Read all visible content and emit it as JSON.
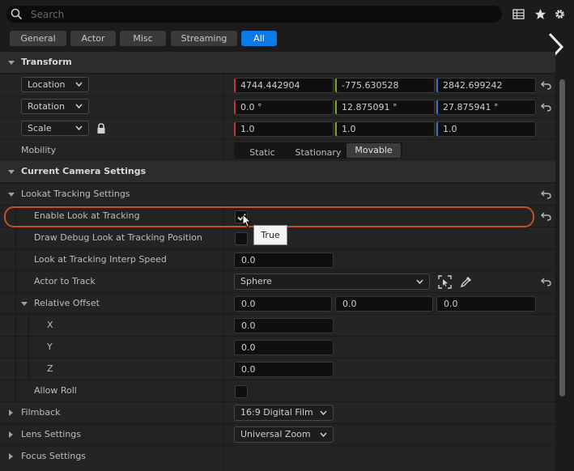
{
  "search": {
    "placeholder": "Search"
  },
  "toolbar_icons": [
    "grid-view-icon",
    "star-icon",
    "gear-icon"
  ],
  "filters": [
    {
      "label": "General",
      "active": false
    },
    {
      "label": "Actor",
      "active": false
    },
    {
      "label": "Misc",
      "active": false
    },
    {
      "label": "Streaming",
      "active": false
    },
    {
      "label": "All",
      "active": true
    }
  ],
  "transform": {
    "title": "Transform",
    "location": {
      "label": "Location",
      "x": "4744.442904",
      "y": "-775.630528",
      "z": "2842.699242"
    },
    "rotation": {
      "label": "Rotation",
      "x": "0.0 °",
      "y": "12.875091 °",
      "z": "27.875941 °"
    },
    "scale": {
      "label": "Scale",
      "x": "1.0",
      "y": "1.0",
      "z": "1.0"
    },
    "mobility": {
      "label": "Mobility",
      "options": [
        "Static",
        "Stationary",
        "Movable"
      ],
      "selected": "Movable"
    }
  },
  "camera_settings": {
    "title": "Current Camera Settings",
    "lookat": {
      "title": "Lookat Tracking Settings",
      "enable": {
        "label": "Enable Look at Tracking",
        "checked": true,
        "tooltip": "True"
      },
      "draw_debug": {
        "label": "Draw Debug Look at Tracking Position"
      },
      "interp_speed": {
        "label": "Look at Tracking Interp Speed",
        "value": "0.0"
      },
      "actor_to_track": {
        "label": "Actor to Track",
        "value": "Sphere"
      },
      "relative_offset": {
        "label": "Relative Offset",
        "x": "0.0",
        "y": "0.0",
        "z": "0.0",
        "x_label": "X",
        "y_label": "Y",
        "z_label": "Z",
        "x_value": "0.0",
        "y_value": "0.0",
        "z_value": "0.0"
      },
      "allow_roll": {
        "label": "Allow Roll"
      }
    },
    "filmback": {
      "label": "Filmback",
      "value": "16:9 Digital Film"
    },
    "lens": {
      "label": "Lens Settings",
      "value": "Universal Zoom"
    },
    "focus": {
      "label": "Focus Settings"
    }
  },
  "colors": {
    "accent": "#0c79e6",
    "highlight": "#c2512c",
    "x_axis": "#c8333a",
    "y_axis": "#7ca52b",
    "z_axis": "#3c6fd1"
  }
}
